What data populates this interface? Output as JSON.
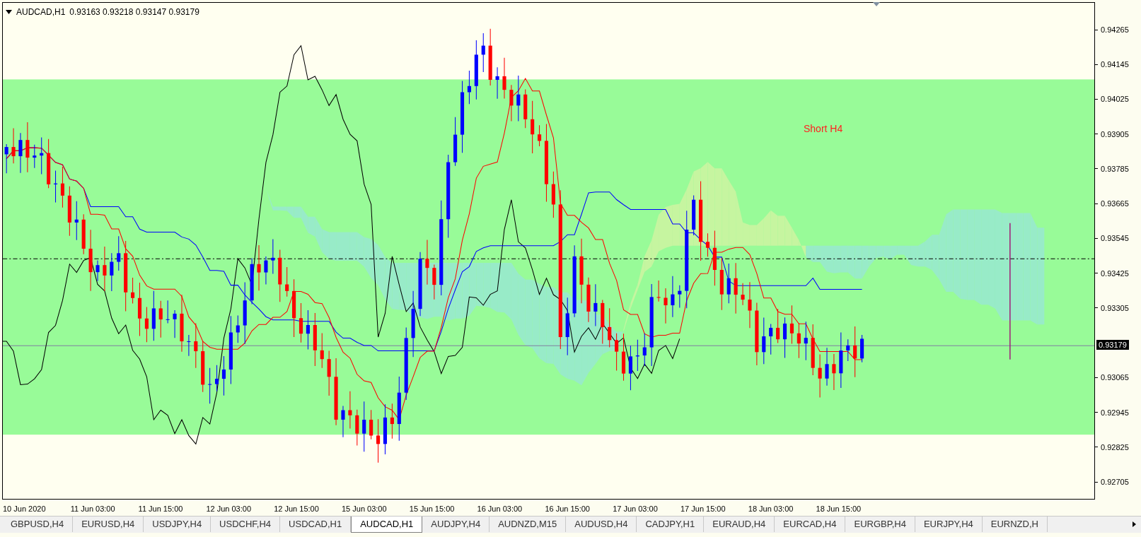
{
  "chart": {
    "symbol": "AUDCAD,H1",
    "quotes": "0.93163 0.93218 0.93147 0.93179",
    "zone_label": "Short H4",
    "price_ticks": [
      "0.94265",
      "0.94145",
      "0.94025",
      "0.93905",
      "0.93785",
      "0.93665",
      "0.93545",
      "0.93425",
      "0.93305",
      "0.93065",
      "0.92945",
      "0.92825",
      "0.92705"
    ],
    "current_price": "0.93179",
    "time_labels": [
      "10 Jun 2020",
      "11 Jun 03:00",
      "11 Jun 15:00",
      "12 Jun 03:00",
      "12 Jun 15:00",
      "15 Jun 03:00",
      "15 Jun 15:00",
      "16 Jun 03:00",
      "16 Jun 15:00",
      "17 Jun 03:00",
      "17 Jun 15:00",
      "18 Jun 03:00",
      "18 Jun 15:00"
    ]
  },
  "tabs": [
    {
      "label": "GBPUSD,H4",
      "selected": false
    },
    {
      "label": "EURUSD,H4",
      "selected": false
    },
    {
      "label": "USDJPY,H4",
      "selected": false
    },
    {
      "label": "USDCHF,H4",
      "selected": false
    },
    {
      "label": "USDCAD,H1",
      "selected": false
    },
    {
      "label": "AUDCAD,H1",
      "selected": true
    },
    {
      "label": "AUDJPY,H4",
      "selected": false
    },
    {
      "label": "AUDNZD,M15",
      "selected": false
    },
    {
      "label": "AUDUSD,H4",
      "selected": false
    },
    {
      "label": "CADJPY,H1",
      "selected": false
    },
    {
      "label": "EURAUD,H4",
      "selected": false
    },
    {
      "label": "EURCAD,H4",
      "selected": false
    },
    {
      "label": "EURGBP,H4",
      "selected": false
    },
    {
      "label": "EURJPY,H4",
      "selected": false
    },
    {
      "label": "EURNZD,H",
      "selected": false
    }
  ]
}
